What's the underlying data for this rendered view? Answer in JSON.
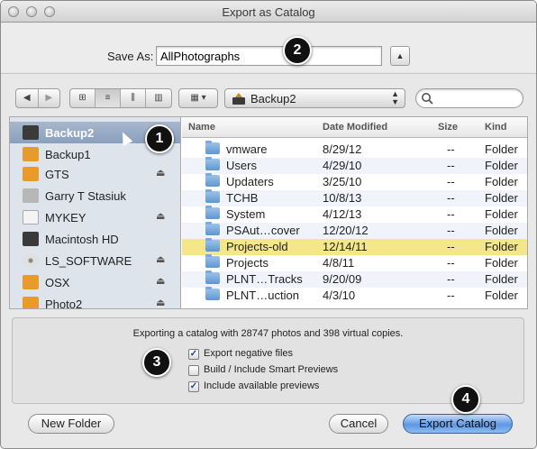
{
  "window": {
    "title": "Export as Catalog"
  },
  "save_as": {
    "label": "Save As:",
    "value": "AllPhotographs",
    "expand_icon": "disclosure-up-icon"
  },
  "toolbar": {
    "back_icon": "◀",
    "forward_icon": "▶",
    "view_icons": [
      "⊞",
      "≡",
      "⫼",
      "▥"
    ],
    "arrange_icon": "▦ ▾",
    "location": "Backup2",
    "search_placeholder": ""
  },
  "sidebar": {
    "items": [
      {
        "label": "Backup2",
        "icon": "drive-icon",
        "color": "#3a3a3a",
        "selected": true,
        "eject": false
      },
      {
        "label": "Backup1",
        "icon": "drive-icon",
        "color": "#e89a2a",
        "selected": false,
        "eject": false
      },
      {
        "label": "GTS",
        "icon": "drive-icon",
        "color": "#e89a2a",
        "selected": false,
        "eject": true
      },
      {
        "label": "Garry T Stasiuk",
        "icon": "drive-icon",
        "color": "#b7b7b7",
        "selected": false,
        "eject": false
      },
      {
        "label": "MYKEY",
        "icon": "drive-icon",
        "color": "#f4f4f4",
        "selected": false,
        "eject": true
      },
      {
        "label": "Macintosh HD",
        "icon": "drive-icon",
        "color": "#3a3a3a",
        "selected": false,
        "eject": false
      },
      {
        "label": "LS_SOFTWARE",
        "icon": "disc-icon",
        "color": "#cfcfcf",
        "selected": false,
        "eject": true
      },
      {
        "label": "OSX",
        "icon": "drive-icon",
        "color": "#e89a2a",
        "selected": false,
        "eject": true
      },
      {
        "label": "Photo2",
        "icon": "drive-icon",
        "color": "#e89a2a",
        "selected": false,
        "eject": true
      }
    ]
  },
  "filelist": {
    "columns": {
      "name": "Name",
      "date": "Date Modified",
      "size": "Size",
      "kind": "Kind"
    },
    "rows": [
      {
        "name": "vmware",
        "date": "8/29/12",
        "size": "--",
        "kind": "Folder"
      },
      {
        "name": "Users",
        "date": "4/29/10",
        "size": "--",
        "kind": "Folder"
      },
      {
        "name": "Updaters",
        "date": "3/25/10",
        "size": "--",
        "kind": "Folder"
      },
      {
        "name": "TCHB",
        "date": "10/8/13",
        "size": "--",
        "kind": "Folder"
      },
      {
        "name": "System",
        "date": "4/12/13",
        "size": "--",
        "kind": "Folder"
      },
      {
        "name": "PSAut…cover",
        "date": "12/20/12",
        "size": "--",
        "kind": "Folder"
      },
      {
        "name": "Projects-old",
        "date": "12/14/11",
        "size": "--",
        "kind": "Folder",
        "highlight": true
      },
      {
        "name": "Projects",
        "date": "4/8/11",
        "size": "--",
        "kind": "Folder"
      },
      {
        "name": "PLNT…Tracks",
        "date": "9/20/09",
        "size": "--",
        "kind": "Folder"
      },
      {
        "name": "PLNT…uction",
        "date": "4/3/10",
        "size": "--",
        "kind": "Folder"
      }
    ]
  },
  "options": {
    "summary": "Exporting a catalog with 28747 photos and 398 virtual copies.",
    "checkboxes": [
      {
        "label": "Export negative files",
        "checked": true
      },
      {
        "label": "Build / Include Smart Previews",
        "checked": false
      },
      {
        "label": "Include available previews",
        "checked": true
      }
    ]
  },
  "buttons": {
    "new_folder": "New Folder",
    "cancel": "Cancel",
    "export": "Export Catalog"
  },
  "callouts": [
    "1",
    "2",
    "3",
    "4"
  ],
  "colors": {
    "accent": "#5d98e4",
    "highlight_row": "#f4e78b",
    "sidebar_bg": "#dde4ec"
  }
}
